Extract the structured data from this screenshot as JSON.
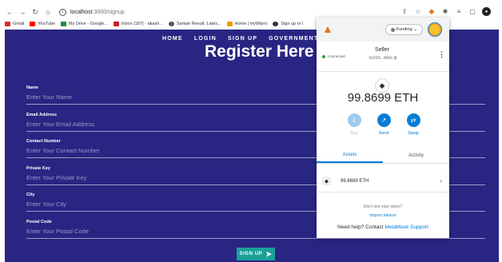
{
  "browser": {
    "url_host": "localhost",
    "url_path": ":3000/signup"
  },
  "bookmarks": [
    {
      "label": "Gmail",
      "color": "#d93025"
    },
    {
      "label": "YouTube",
      "color": "#ff0000"
    },
    {
      "label": "My Drive - Google...",
      "color": "#1e8e3e"
    },
    {
      "label": "Inbox (187) - akash...",
      "color": "#c5221f"
    },
    {
      "label": "Sarkari Result, Lates...",
      "color": "#555555"
    },
    {
      "label": "Home | myWipro",
      "color": "#f29900"
    },
    {
      "label": "Sign up or l",
      "color": "#333333"
    }
  ],
  "page": {
    "nav": [
      "HOME",
      "LOGIN",
      "SIGN UP",
      "GOVERNMENT LO"
    ],
    "title": "Register Here",
    "fields": [
      {
        "label": "Name",
        "placeholder": "Enter Your Name"
      },
      {
        "label": "Email Address",
        "placeholder": "Enter Your Email Address"
      },
      {
        "label": "Contact Number",
        "placeholder": "Enter Your Contact Number"
      },
      {
        "label": "Private Key",
        "placeholder": "Enter Your Private Key"
      },
      {
        "label": "City",
        "placeholder": "Enter Your City"
      },
      {
        "label": "Postal Code",
        "placeholder": "Enter Your Postal Code"
      }
    ],
    "signup_button": "SIGN UP",
    "background_color": "#292582",
    "button_color": "#1aa198"
  },
  "metamask": {
    "network": "Funding",
    "status": "Connected",
    "account_name": "Seller",
    "account_address": "0x02A...8A0c",
    "balance": "99.8699 ETH",
    "actions": [
      "Buy",
      "Send",
      "Swap"
    ],
    "tabs": [
      "Assets",
      "Activity"
    ],
    "asset": "99.8699 ETH",
    "no_token_text": "Don't see your token?",
    "import_tokens": "Import tokens",
    "help_prefix": "Need help? Contact",
    "help_link": "MetaMask Support",
    "accent_color": "#037dd6"
  }
}
